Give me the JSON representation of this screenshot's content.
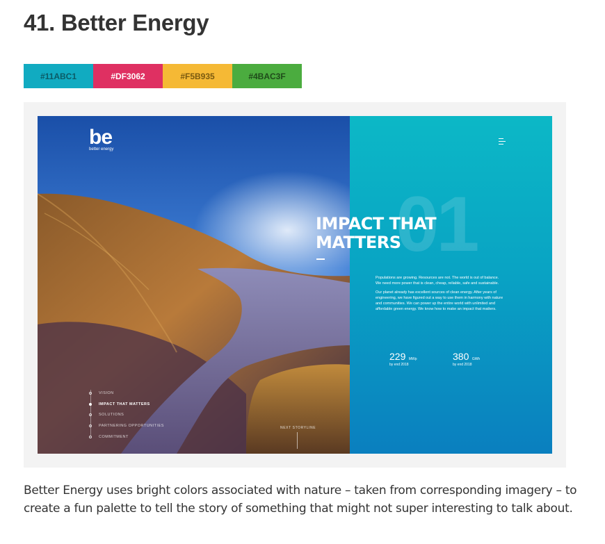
{
  "article": {
    "title": "41. Better Energy",
    "caption": "Better Energy uses bright colors associated with nature – taken from corresponding imagery – to create a fun palette to tell the story of something that might not super interesting to talk about."
  },
  "palette": [
    {
      "hex": "#11ABC1",
      "text_color": "#0b5b66"
    },
    {
      "hex": "#DF3062",
      "text_color": "#ffffff"
    },
    {
      "hex": "#F5B935",
      "text_color": "#7a5a10"
    },
    {
      "hex": "#4BAC3F",
      "text_color": "#1f4a1a"
    }
  ],
  "screenshot": {
    "logo_mark": "be",
    "logo_word": "better energy",
    "menu_icon": "hamburger-icon",
    "big_number": "01",
    "headline_line1": "IMPACT THAT",
    "headline_line2": "MATTERS",
    "paragraph1": "Populations are growing. Resources are not. The world is out of balance. We need more power that is clean, cheap, reliable, safe and sustainable.",
    "paragraph2": "Our planet already has excellent sources of clean energy. After years of engineering, we have figured out a way to use them in harmony with nature and communities. We can power up the entire world with unlimited and affordable green energy. We know how to make an impact that matters.",
    "stats": [
      {
        "value": "229",
        "unit": "MWp",
        "note": "by end 2018"
      },
      {
        "value": "380",
        "unit": "GWh",
        "note": "by end 2018"
      }
    ],
    "nav_items": [
      "VISION",
      "IMPACT THAT MATTERS",
      "SOLUTIONS",
      "PARTNERING OPPORTUNITIES",
      "COMMITMENT"
    ],
    "nav_active_index": 1,
    "next_label": "NEXT STORYLINE",
    "colors": {
      "panel_top": "#0cb8c6",
      "panel_bottom": "#0a7fbf"
    }
  }
}
